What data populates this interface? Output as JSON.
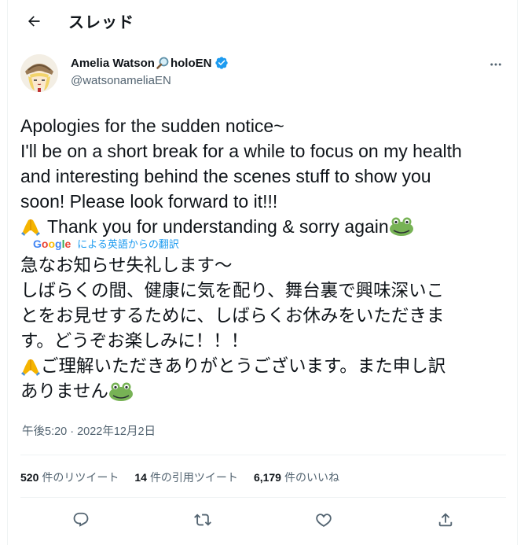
{
  "header": {
    "title": "スレッド"
  },
  "author": {
    "display_name": "Amelia Watson",
    "name_suffix": "holoEN",
    "handle": "@watsonameliaEN"
  },
  "tweet": {
    "lines": [
      "Apologies for the sudden notice~",
      "I'll be on a short break for a while to focus on my health",
      "and interesting behind the scenes stuff to show you",
      "soon! Please look forward to it!!!",
      "Thank you for understanding & sorry again"
    ],
    "translate_brand": "Google",
    "translate_label": "による英語からの翻訳",
    "jp_lines": [
      "急なお知らせ失礼します～",
      "しばらくの間、健康に気を配り、舞台裏で興味深いこ",
      "とをお見せするために、しばらくお休みをいただきま",
      "す。どうぞお楽しみに！！！",
      "ご理解いただきありがとうございます。また申し訳",
      "ありません"
    ],
    "timestamp": "午後5:20 · 2022年12月2日"
  },
  "stats": {
    "retweets_count": "520",
    "retweets_label": "件のリツイート",
    "quotes_count": "14",
    "quotes_label": "件の引用ツイート",
    "likes_count": "6,179",
    "likes_label": "件のいいね"
  },
  "colors": {
    "accent": "#1d9bf0",
    "secondary_text": "#536471",
    "divider": "#eff3f4"
  },
  "icons": [
    "back-arrow-icon",
    "magnifying-glass-icon",
    "verified-badge-icon",
    "more-icon",
    "folded-hands-icon",
    "frog-icon",
    "reply-icon",
    "retweet-icon",
    "like-icon",
    "share-icon"
  ]
}
